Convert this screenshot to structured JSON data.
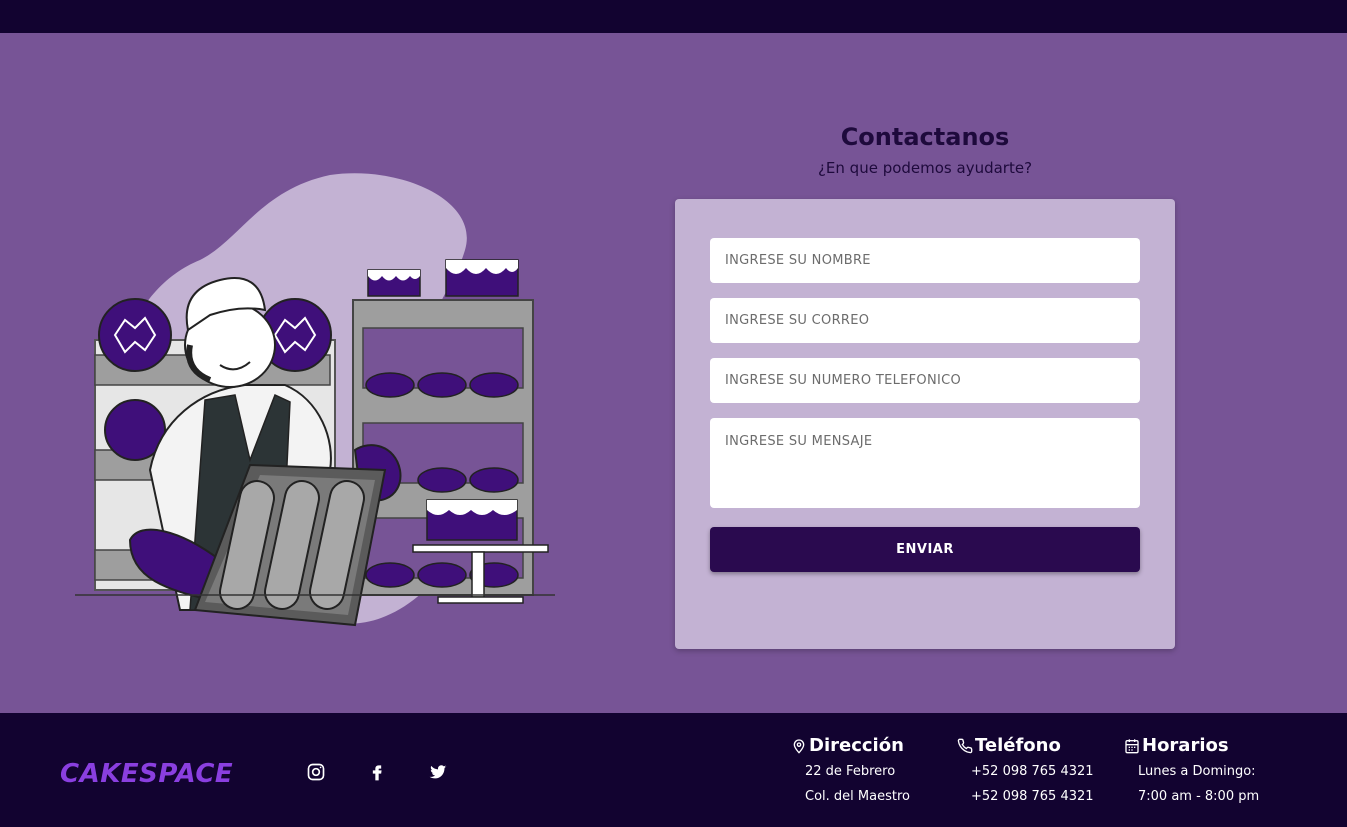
{
  "contact": {
    "title": "Contactanos",
    "subtitle": "¿En que podemos ayudarte?",
    "fields": {
      "name_placeholder": "INGRESE SU NOMBRE",
      "email_placeholder": "INGRESE SU CORREO",
      "phone_placeholder": "INGRESE SU NÚMERO TELEFÓNICO",
      "message_placeholder": "INGRESE SU MENSAJE"
    },
    "submit_label": "ENVIAR"
  },
  "footer": {
    "brand": "CAKESPACE",
    "social": [
      "instagram-icon",
      "facebook-icon",
      "twitter-icon"
    ],
    "address": {
      "title": "Dirección",
      "icon": "map-pin-icon",
      "lines": [
        "22 de Febrero",
        "Col. del Maestro"
      ]
    },
    "phone": {
      "title": "Teléfono",
      "icon": "phone-icon",
      "lines": [
        "+52 098 765 4321",
        "+52 098 765 4321"
      ]
    },
    "hours": {
      "title": "Horarios",
      "icon": "calendar-icon",
      "lines": [
        "Lunes a Domingo:",
        "7:00 am - 8:00 pm"
      ]
    }
  },
  "colors": {
    "topbar": "#120330",
    "background": "#775496",
    "card": "#c3b2d3",
    "button": "#2a0a4f",
    "brand": "#8a3fe0"
  }
}
